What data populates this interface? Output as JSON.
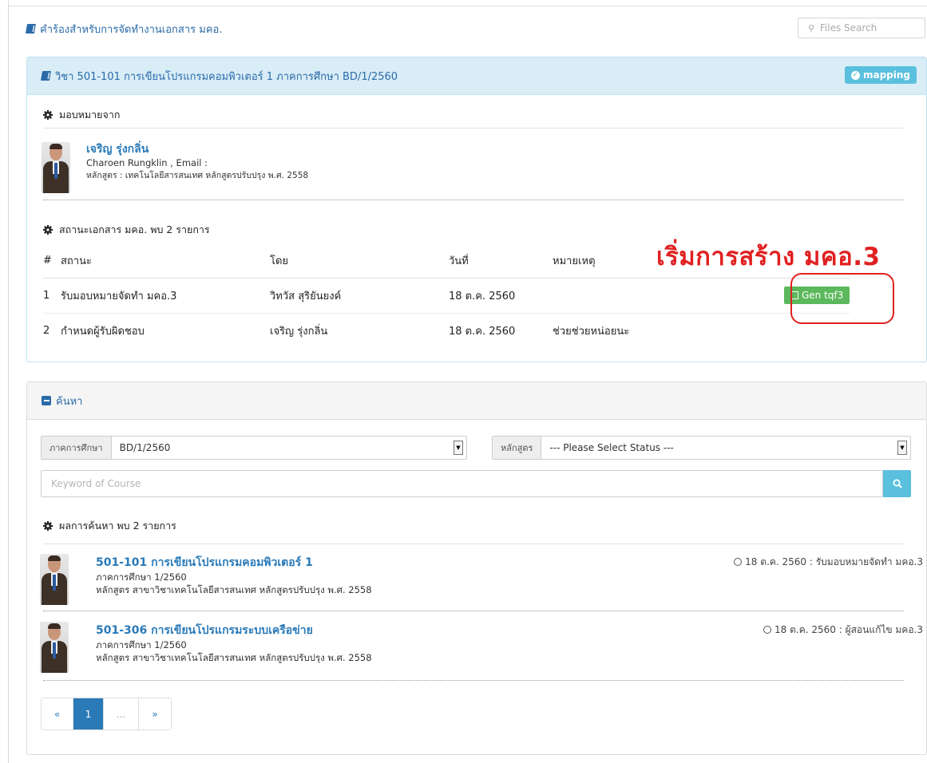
{
  "header": {
    "title": "คำร้องสำหรับการจัดทำงานเอกสาร มคอ.",
    "search_placeholder": "Files Search"
  },
  "course_panel": {
    "title": "วิชา 501-101 การเขียนโปรแกรมคอมพิวเตอร์ 1 ภาคการศึกษา BD/1/2560",
    "mapping_label": "mapping",
    "assigned_from_label": "มอบหมายจาก",
    "assigner": {
      "name": "เจริญ รุ่งกลิ่น",
      "name_email": "Charoen Rungklin , Email :",
      "program": "หลักสูตร : เทคโนโลยีสารสนเทศ หลักสูตรปรับปรุง พ.ศ. 2558"
    },
    "status_label": "สถานะเอกสาร มคอ. พบ 2 รายการ",
    "columns": [
      "#",
      "สถานะ",
      "โดย",
      "วันที่",
      "หมายเหตุ"
    ],
    "rows": [
      {
        "no": "1",
        "status": "รับมอบหมายจัดทำ มคอ.3",
        "by": "วิทวัส สุริยันยงค์",
        "date": "18 ต.ค. 2560",
        "note": "",
        "action": "Gen tqf3"
      },
      {
        "no": "2",
        "status": "กำหนดผู้รับผิดชอบ",
        "by": "เจริญ รุ่งกลิ่น",
        "date": "18 ต.ค. 2560",
        "note": "ช่วยช่วยหน่อยนะ",
        "action": ""
      }
    ]
  },
  "annotation": {
    "text": "เริ่มการสร้าง มคอ.3",
    "color": "#e02020"
  },
  "search_panel": {
    "title": "ค้นหา",
    "semester_label": "ภาคการศึกษา",
    "semester_value": "BD/1/2560",
    "program_label": "หลักสูตร",
    "program_value": "--- Please Select Status ---",
    "keyword_placeholder": "Keyword of Course",
    "results_label": "ผลการค้นหา พบ 2 รายการ",
    "results": [
      {
        "course": "501-101 การเขียนโปรแกรมคอมพิวเตอร์ 1",
        "semester": "ภาคการศึกษา 1/2560",
        "program": "หลักสูตร สาขาวิชาเทคโนโลยีสารสนเทศ หลักสูตรปรับปรุง พ.ศ. 2558",
        "meta": "18 ต.ค. 2560 : รับมอบหมายจัดทำ มคอ.3"
      },
      {
        "course": "501-306 การเขียนโปรแกรมระบบเครือข่าย",
        "semester": "ภาคการศึกษา 1/2560",
        "program": "หลักสูตร สาขาวิชาเทคโนโลยีสารสนเทศ หลักสูตรปรับปรุง พ.ศ. 2558",
        "meta": "18 ต.ค. 2560 : ผู้สอนแก้ไข มคอ.3"
      }
    ],
    "pagination": {
      "prev": "«",
      "current": "1",
      "ellipsis": "...",
      "next": "»"
    }
  },
  "colors": {
    "accent": "#2a7ab8",
    "info_bg": "#d9edf7",
    "mapping": "#5bc0de",
    "success": "#5cb85c"
  }
}
